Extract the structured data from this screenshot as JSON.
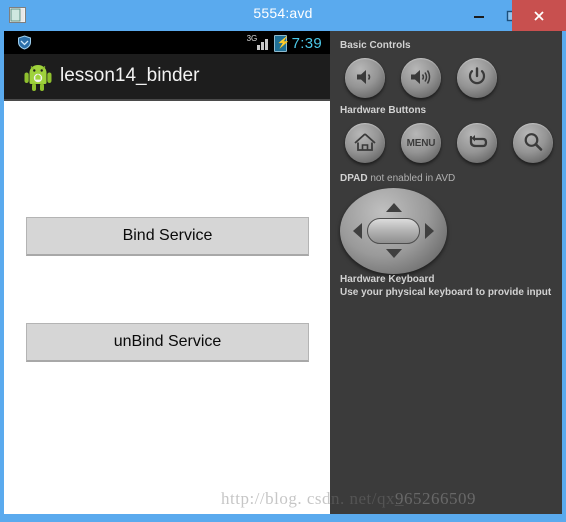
{
  "window": {
    "title": "5554:avd",
    "icon": "window-icon",
    "controls": {
      "minimize": "–",
      "maximize": "□",
      "close": "✕"
    },
    "frame_color": "#5aaaee",
    "close_color": "#c8504f"
  },
  "phone": {
    "status_bar": {
      "network": "3G",
      "time": "7:39",
      "time_color": "#4cc8e8",
      "battery_icon": "battery-charging-icon",
      "signal_icon": "signal-bars-icon",
      "shield_icon": "shield-icon"
    },
    "action_bar": {
      "app_icon": "android-robot-icon",
      "app_title": "lesson14_binder",
      "background": "#1d1d1d"
    },
    "buttons": [
      {
        "label": "Bind Service",
        "name": "bind-service-button"
      },
      {
        "label": "unBind Service",
        "name": "unbind-service-button"
      }
    ]
  },
  "panel": {
    "background": "#3b3b3b",
    "sections": {
      "basic_controls": {
        "label": "Basic Controls",
        "buttons": [
          {
            "label": "",
            "icon": "volume-down-icon",
            "name": "volume-down-button"
          },
          {
            "label": "",
            "icon": "volume-up-icon",
            "name": "volume-up-button"
          },
          {
            "label": "",
            "icon": "power-icon",
            "name": "power-button"
          }
        ]
      },
      "hardware_buttons": {
        "label": "Hardware Buttons",
        "buttons": [
          {
            "label": "",
            "icon": "home-icon",
            "name": "home-button"
          },
          {
            "label": "MENU",
            "icon": "menu-icon",
            "name": "menu-button"
          },
          {
            "label": "",
            "icon": "back-arrow-icon",
            "name": "back-button"
          },
          {
            "label": "",
            "icon": "search-icon",
            "name": "search-button"
          }
        ]
      },
      "dpad": {
        "label_main": "DPAD",
        "label_suffix": " not enabled in AVD"
      },
      "hardware_keyboard": {
        "title": "Hardware Keyboard",
        "description": "Use your physical keyboard to provide input"
      }
    }
  },
  "watermark": {
    "url": "http://blog. csdn. net/qx_",
    "overlay": "965266509"
  }
}
